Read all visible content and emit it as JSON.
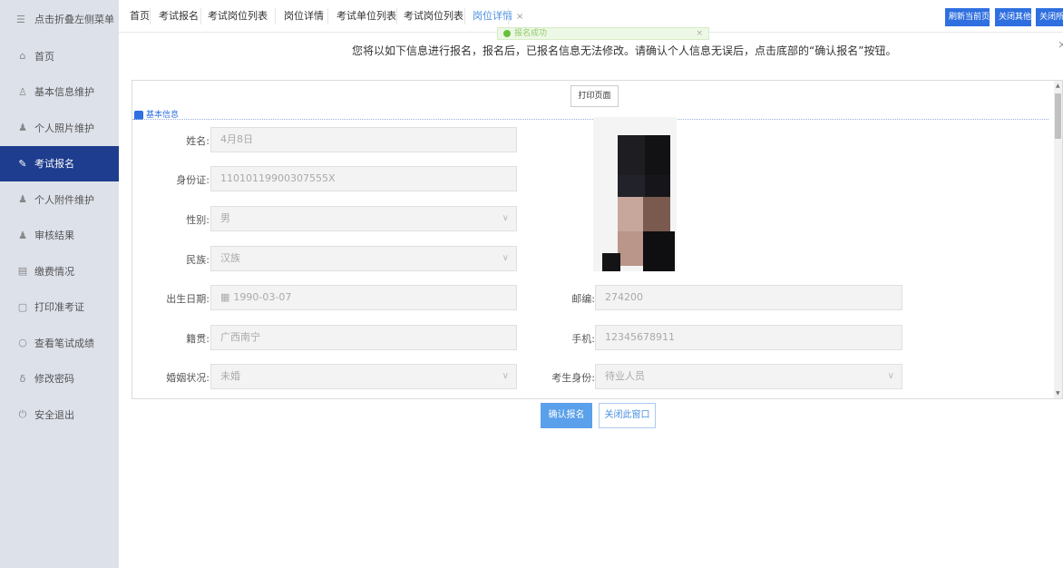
{
  "sidebar": {
    "toggle_label": "点击折叠左侧菜单",
    "toggle_icon": "menu-icon",
    "items": [
      {
        "label": "首页",
        "icon": "home-icon"
      },
      {
        "label": "基本信息维护",
        "icon": "user-icon"
      },
      {
        "label": "个人照片维护",
        "icon": "person-icon"
      },
      {
        "label": "考试报名",
        "icon": "edit-icon"
      },
      {
        "label": "个人附件维护",
        "icon": "person-icon"
      },
      {
        "label": "审核结果",
        "icon": "person-check-icon"
      },
      {
        "label": "缴费情况",
        "icon": "bill-icon"
      },
      {
        "label": "打印准考证",
        "icon": "print-icon"
      },
      {
        "label": "查看笔试成绩",
        "icon": "search-icon"
      },
      {
        "label": "修改密码",
        "icon": "key-icon"
      },
      {
        "label": "安全退出",
        "icon": "power-icon"
      }
    ],
    "active_index": 3,
    "active_color": "#1f3d8e"
  },
  "tabs": [
    {
      "label": "首页"
    },
    {
      "label": "考试报名"
    },
    {
      "label": "考试岗位列表"
    },
    {
      "label": "岗位详情"
    },
    {
      "label": "考试单位列表"
    },
    {
      "label": "考试岗位列表"
    },
    {
      "label": "岗位详情",
      "close": "×"
    }
  ],
  "toolbar": {
    "refresh": "刷新当前页",
    "close_others": "关闭其他",
    "close_all": "关闭所有"
  },
  "toast": {
    "text": "报名成功",
    "close": "×"
  },
  "notice": {
    "text": "您将以如下信息进行报名，报名后，已报名信息无法修改。请确认个人信息无误后，点击底部的“确认报名”按钮。",
    "close": "×"
  },
  "form": {
    "print_label": "打印页面",
    "section_title": "基本信息",
    "left": [
      {
        "label": "姓名:",
        "value": "4月8日",
        "select": false
      },
      {
        "label": "身份证:",
        "value": "11010119900307555X",
        "select": false
      },
      {
        "label": "性别:",
        "value": "男",
        "select": true
      },
      {
        "label": "民族:",
        "value": "汉族",
        "select": true
      },
      {
        "label": "出生日期:",
        "value": "1990-03-07",
        "select": false,
        "icon": "calendar-icon"
      },
      {
        "label": "籍贯:",
        "value": "广西南宁",
        "select": false
      },
      {
        "label": "婚姻状况:",
        "value": "未婚",
        "select": true
      }
    ],
    "right": [
      {
        "label": "邮编:",
        "value": "274200",
        "select": false
      },
      {
        "label": "手机:",
        "value": "12345678911",
        "select": false
      },
      {
        "label": "考生身份:",
        "value": "待业人员",
        "select": true
      }
    ],
    "confirm_label": "确认报名",
    "close_label": "关闭此窗口",
    "accent_color": "#2f6fe0"
  }
}
